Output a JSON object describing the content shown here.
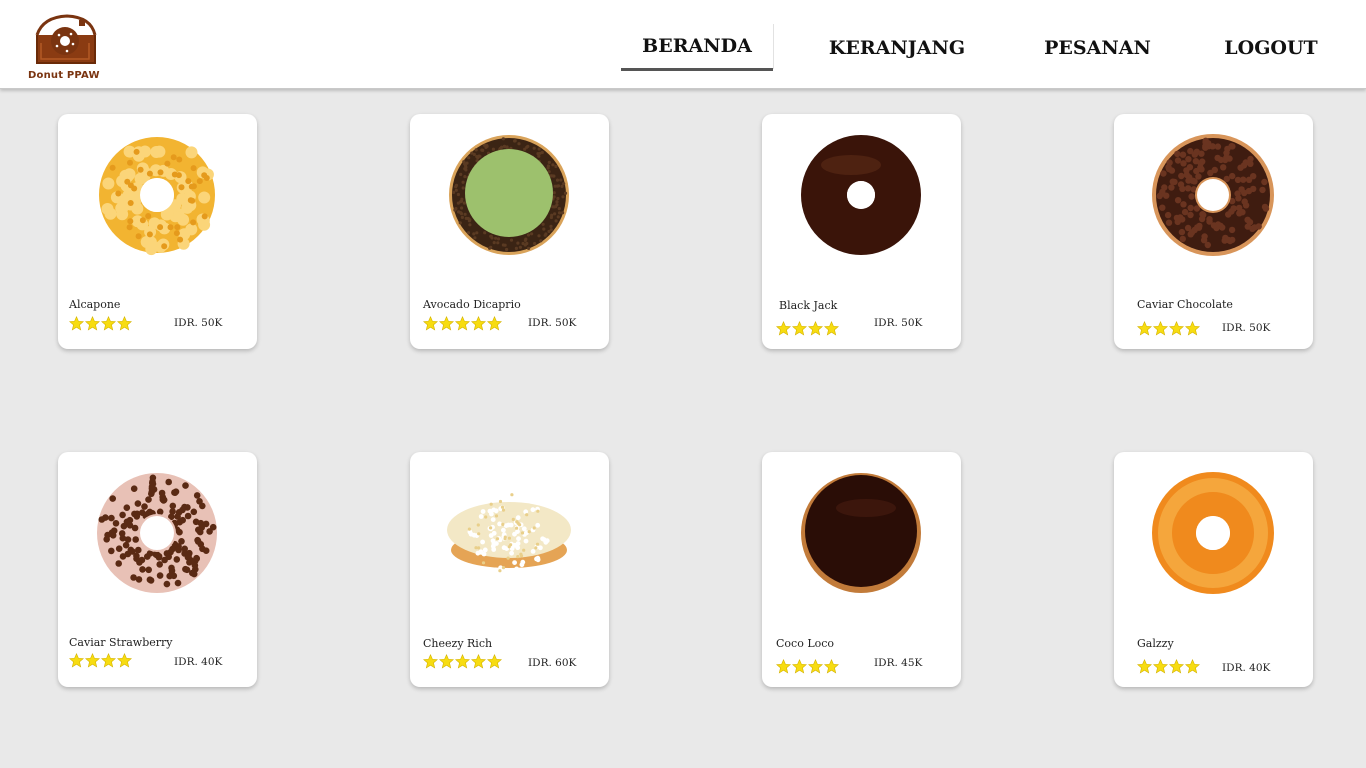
{
  "brand": {
    "logo_text": "Donut PPAW"
  },
  "nav": {
    "home": "BERANDA",
    "cart": "KERANJANG",
    "orders": "PESANAN",
    "logout": "LOGOUT",
    "active": "BERANDA"
  },
  "products": [
    {
      "name": "Alcapone",
      "price": "IDR. 50K",
      "rating": 4,
      "image": "almond-donut"
    },
    {
      "name": "Avocado Dicaprio",
      "price": "IDR. 50K",
      "rating": 5,
      "image": "avocado-donut"
    },
    {
      "name": "Black Jack",
      "price": "IDR. 50K",
      "rating": 4,
      "image": "chocolate-glazed-donut"
    },
    {
      "name": "Caviar Chocolate",
      "price": "IDR. 50K",
      "rating": 4,
      "image": "chocolate-caviar-donut"
    },
    {
      "name": "Caviar Strawberry",
      "price": "IDR. 40K",
      "rating": 4,
      "image": "strawberry-caviar-donut"
    },
    {
      "name": "Cheezy Rich",
      "price": "IDR. 60K",
      "rating": 5,
      "image": "cheese-donut"
    },
    {
      "name": "Coco Loco",
      "price": "IDR. 45K",
      "rating": 4,
      "image": "chocolate-filled-donut"
    },
    {
      "name": "Galzzy",
      "price": "IDR. 40K",
      "rating": 4,
      "image": "glazed-donut"
    }
  ],
  "colors": {
    "accent_brown": "#7a3410",
    "star_yellow": "#f7dc11",
    "background": "#e9e9e9"
  }
}
